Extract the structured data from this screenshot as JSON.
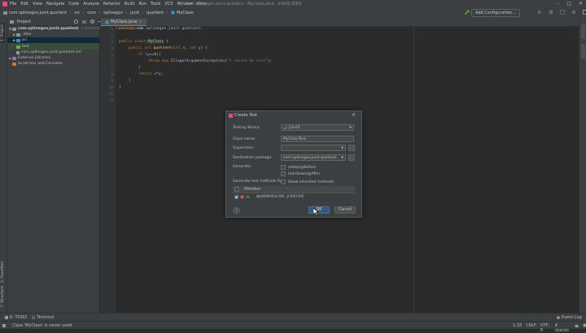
{
  "menu": {
    "items": [
      "File",
      "Edit",
      "View",
      "Navigate",
      "Code",
      "Analyze",
      "Refactor",
      "Build",
      "Run",
      "Tools",
      "VCS",
      "Window",
      "Help"
    ],
    "window_title": "com.splinegov.junit.quotient - MyClass.java - IntelliJ IDEA"
  },
  "nav": {
    "breadcrumbs": [
      "com.splinegov.junit.quotient",
      "src",
      "com",
      "splinegov",
      "junit",
      "quotient",
      "MyClass"
    ],
    "add_config": "Add Configuration..."
  },
  "tool_windows": {
    "project": "1: Project",
    "structure": "7: Structure",
    "favorites": "2: Favorites"
  },
  "project_panel": {
    "title": "Project",
    "tree": [
      {
        "label": "com.splinegov.junit.quotient",
        "detail": "C:\\Users\\Ahmed\\Documents\\junit"
      },
      {
        "label": ".idea",
        "detail": ""
      },
      {
        "label": "src",
        "detail": ""
      },
      {
        "label": "test",
        "detail": ""
      },
      {
        "label": "com.splinegov.junit.quotient.iml",
        "detail": ""
      },
      {
        "label": "External Libraries",
        "detail": ""
      },
      {
        "label": "Scratches and Consoles",
        "detail": ""
      }
    ]
  },
  "editor": {
    "tab_label": "MyClass.java",
    "line_numbers": [
      "1",
      "2",
      "3",
      "4",
      "5",
      "6",
      "7",
      "8",
      "9",
      "10",
      "11",
      "12"
    ],
    "lines": {
      "l1_kw": "package",
      "l1_rest": " com.splinegov.junit.quotient;",
      "l3_kw": "public class",
      "l3_name": " MyClass",
      "l3_rest": " {",
      "l4_kw": "public int",
      "l4_name": " quotient",
      "l4_p1": "(",
      "l4_kw2": "int",
      "l4_p2": " x, ",
      "l4_kw3": "int",
      "l4_p3": " y) {",
      "l5_kw": "if",
      "l5_rest": " (y==0){",
      "l6_kw": "throw new",
      "l6_cls": " IllegalArgumentException(",
      "l6_str": "\"Y cannot be zero\"",
      "l6_end": ");",
      "l7": "}",
      "l8_kw": "return",
      "l8_rest": " x*y;",
      "l9": "}",
      "l10": "}"
    }
  },
  "dialog": {
    "title": "Create Test",
    "labels": {
      "testing_library": "Testing library:",
      "class_name": "Class name:",
      "superclass": "Superclass:",
      "destination_package": "Destination package:",
      "generate": "Generate:",
      "generate_methods": "Generate test methods for:"
    },
    "values": {
      "testing_library": "JUnit4",
      "class_name": "MyClassTest",
      "superclass": "",
      "destination_package": "com.splinegov.junit.quotient"
    },
    "checkboxes": {
      "setup": "setUp/@Before",
      "teardown": "tearDown/@After",
      "show_inherited": "Show inherited methods"
    },
    "table": {
      "header": "Member",
      "row": "quotient(x:int, y:int):int",
      "row_checked": true
    },
    "ok_label": "OK",
    "cancel_label": "Cancel",
    "help_label": "?",
    "dots_label": "..."
  },
  "bottom": {
    "todo": "6: TODO",
    "terminal": "Terminal",
    "event_log": "Event Log"
  },
  "status": {
    "message": "Class 'MyClass' is never used",
    "position": "1:33",
    "line_sep": "CRLF",
    "encoding": "UTF-8",
    "indent": "4 spaces"
  },
  "colors": {
    "accent": "#365880",
    "junit_green": "#4caf50",
    "keyword": "#cc7832",
    "method": "#ffc66d",
    "string": "#6a8759"
  }
}
